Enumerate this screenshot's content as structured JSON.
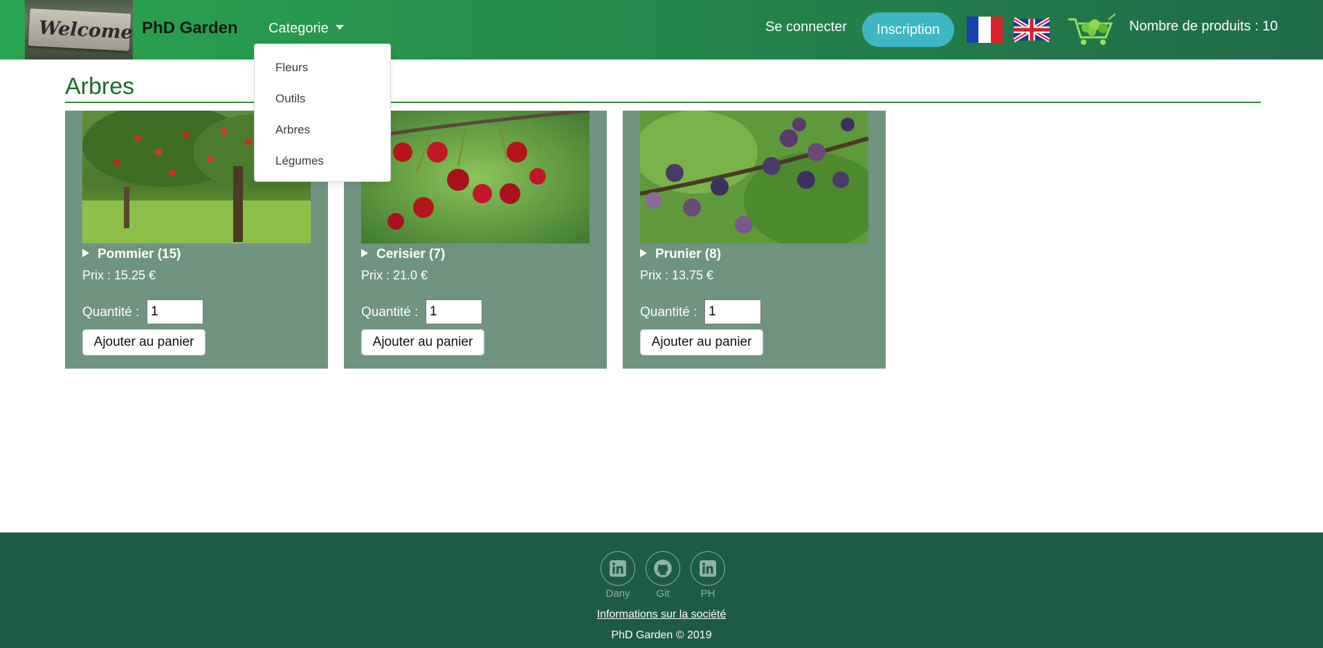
{
  "navbar": {
    "logo_text": "Welcome",
    "brand": "PhD Garden",
    "category_label": "Categorie",
    "login_label": "Se connecter",
    "signup_label": "Inscription",
    "product_count": "Nombre de produits : 10"
  },
  "dropdown": {
    "items": [
      "Fleurs",
      "Outils",
      "Arbres",
      "Légumes"
    ]
  },
  "page": {
    "title": "Arbres"
  },
  "products": [
    {
      "name": "Pommier (15)",
      "price": "Prix : 15.25 €",
      "quantity_label": "Quantité :",
      "quantity": "1",
      "add_label": "Ajouter au panier"
    },
    {
      "name": "Cerisier (7)",
      "price": "Prix : 21.0 €",
      "quantity_label": "Quantité :",
      "quantity": "1",
      "add_label": "Ajouter au panier"
    },
    {
      "name": "Prunier (8)",
      "price": "Prix : 13.75 €",
      "quantity_label": "Quantité :",
      "quantity": "1",
      "add_label": "Ajouter au panier"
    }
  ],
  "footer": {
    "social": [
      {
        "label": "Dany",
        "icon": "linkedin-icon"
      },
      {
        "label": "Git",
        "icon": "github-icon"
      },
      {
        "label": "PH",
        "icon": "linkedin-icon"
      }
    ],
    "info_link": "Informations sur la société",
    "copyright": "PhD Garden © 2019"
  },
  "colors": {
    "navbar_start": "#2aa44e",
    "navbar_end": "#1f6b4a",
    "signup_button": "#3fb6c6",
    "card_bg": "#6f9480",
    "title_green": "#1d6b2c",
    "footer_bg": "#1e5a48"
  }
}
